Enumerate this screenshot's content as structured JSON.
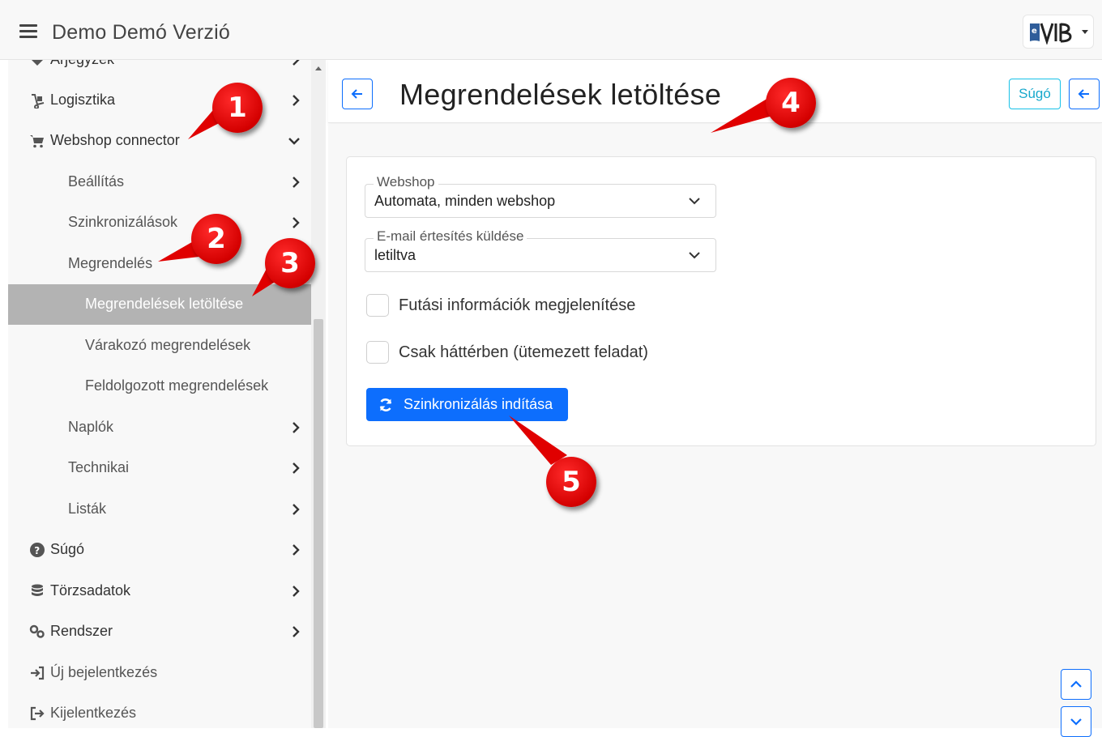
{
  "app": {
    "title": "Demo Demó Verzió"
  },
  "sidebar": {
    "items": [
      {
        "label": "Árjegyzék"
      },
      {
        "label": "Logisztika"
      },
      {
        "label": "Webshop connector"
      },
      {
        "label": "Beállítás"
      },
      {
        "label": "Szinkronizálások"
      },
      {
        "label": "Megrendelés"
      },
      {
        "label": "Megrendelések letöltése"
      },
      {
        "label": "Várakozó megrendelések"
      },
      {
        "label": "Feldolgozott megrendelések"
      },
      {
        "label": "Naplók"
      },
      {
        "label": "Technikai"
      },
      {
        "label": "Listák"
      },
      {
        "label": "Súgó"
      },
      {
        "label": "Törzsadatok"
      },
      {
        "label": "Rendszer"
      },
      {
        "label": "Új bejelentkezés"
      },
      {
        "label": "Kijelentkezés"
      }
    ]
  },
  "header": {
    "title": "Megrendelések letöltése",
    "help_label": "Súgó"
  },
  "form": {
    "webshop": {
      "legend": "Webshop",
      "value": "Automata, minden webshop"
    },
    "email": {
      "legend": "E-mail értesítés küldése",
      "value": "letiltva"
    },
    "show_info_label": "Futási információk megjelenítése",
    "background_label": "Csak háttérben (ütemezett feladat)",
    "sync_button": "Szinkronizálás indítása"
  },
  "annotations": [
    "1",
    "2",
    "3",
    "4",
    "5"
  ],
  "colors": {
    "primary": "#0d6efd",
    "info": "#17c1e8",
    "active_bg": "#b3b3b3",
    "marker": "#e00000"
  }
}
